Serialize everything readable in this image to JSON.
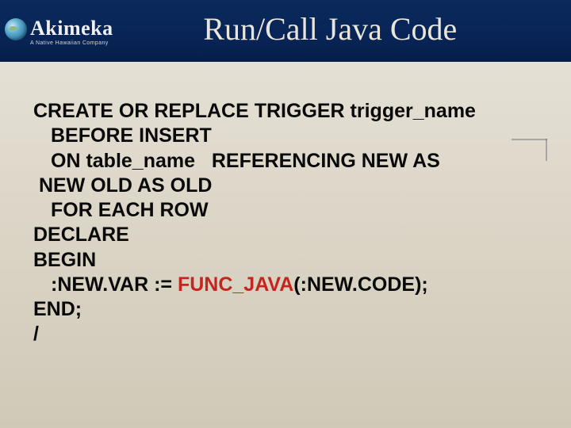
{
  "logo": {
    "main": "Akimeka",
    "tagline": "A Native Hawaiian Company"
  },
  "title": "Run/Call Java Code",
  "code": {
    "l1": "CREATE OR REPLACE TRIGGER trigger_name",
    "l2": "BEFORE INSERT",
    "l3": "ON table_name   REFERENCING NEW AS",
    "l3b": " NEW OLD AS OLD",
    "l4": "FOR EACH ROW",
    "l5": "DECLARE",
    "l6": "BEGIN",
    "l7a": ":NEW.VAR := ",
    "l7b": "FUNC_JAVA",
    "l7c": "(:NEW.CODE);",
    "l8": "END;",
    "l9": "/"
  }
}
